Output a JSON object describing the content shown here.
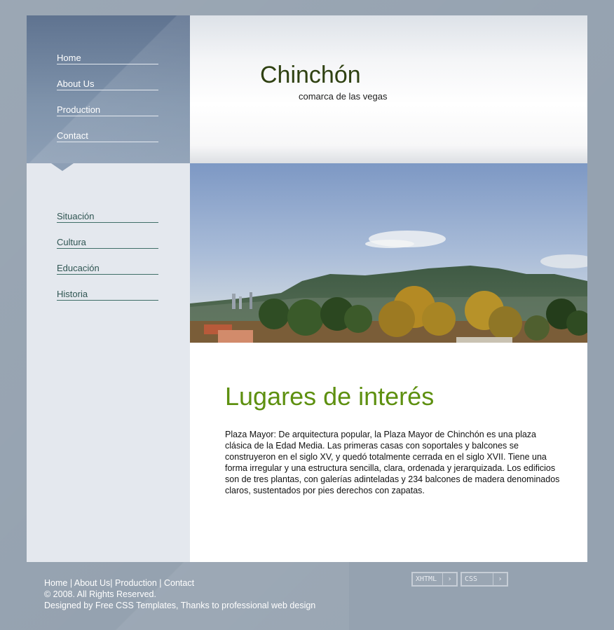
{
  "site": {
    "title": "Chinchón",
    "subtitle": "comarca de las vegas"
  },
  "nav_primary": [
    {
      "label": "Home"
    },
    {
      "label": "About Us"
    },
    {
      "label": "Production"
    },
    {
      "label": "Contact"
    }
  ],
  "nav_secondary": [
    {
      "label": "Situación"
    },
    {
      "label": "Cultura"
    },
    {
      "label": "Educación"
    },
    {
      "label": "Historia"
    }
  ],
  "content": {
    "heading": "Lugares de interés",
    "paragraph": "Plaza Mayor: De arquitectura popular, la Plaza Mayor de Chinchón es una plaza clásica de la Edad Media. Las primeras casas con soportales y balcones se construyeron en el siglo XV, y quedó totalmente cerrada en el siglo XVII. Tiene una forma irregular y una estructura sencilla, clara, ordenada y jerarquizada. Los edificios son de tres plantas, con galerías adinteladas y 234 balcones de madera denominados claros, sustentados por pies derechos con zapatas."
  },
  "footer": {
    "links": [
      {
        "label": "Home"
      },
      {
        "label": "About Us"
      },
      {
        "label": "Production"
      },
      {
        "label": "Contact"
      }
    ],
    "sep1": " | ",
    "sep2": "| ",
    "sep3": " | ",
    "copyright": "© 2008. All Rights Reserved.",
    "credits": "Designed by Free CSS Templates, Thanks to professional web design"
  },
  "badges": {
    "xhtml": "XHTML",
    "css": "CSS",
    "arrow": "›"
  },
  "colors": {
    "page_bg": "#95a2b0",
    "heading_green": "#5e9010",
    "title_dark_green": "#2f4112",
    "sidebar_link": "#2f5552"
  },
  "images": {
    "header_photo": "landscape-mountains-trees"
  }
}
